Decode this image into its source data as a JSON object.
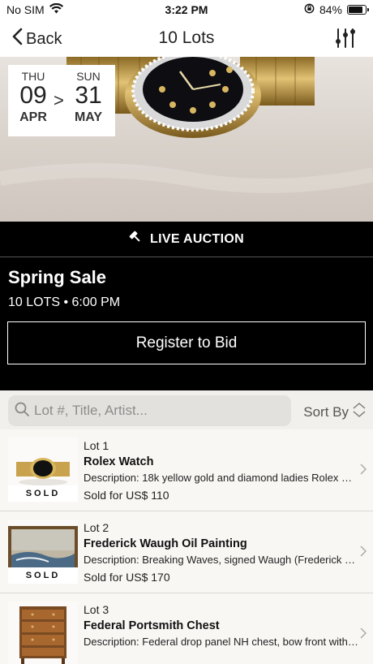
{
  "status_bar": {
    "carrier": "No SIM",
    "time": "3:22 PM",
    "battery": "84%",
    "battery_level": 0.84
  },
  "nav": {
    "back_label": "Back",
    "title": "10 Lots"
  },
  "hero": {
    "start": {
      "dow": "THU",
      "day": "09",
      "month": "APR"
    },
    "separator": ">",
    "end": {
      "dow": "SUN",
      "day": "31",
      "month": "MAY"
    }
  },
  "live_label": "LIVE AUCTION",
  "sale": {
    "name": "Spring Sale",
    "meta": "10 LOTS • 6:00 PM",
    "register_label": "Register to Bid"
  },
  "search": {
    "placeholder": "Lot #, Title, Artist...",
    "value": ""
  },
  "sort_label": "Sort By",
  "lots": [
    {
      "lot": "Lot 1",
      "title": "Rolex Watch",
      "description": "Description: 18k yellow gold and diamond ladies Rolex Datejust watch",
      "price": "Sold for US$ 110",
      "badge": "SOLD"
    },
    {
      "lot": "Lot 2",
      "title": "Frederick Waugh Oil Painting",
      "description": "Description: Breaking Waves, signed Waugh (Frederick Judd Waugh)",
      "price": "Sold for US$ 170",
      "badge": "SOLD"
    },
    {
      "lot": "Lot 3",
      "title": "Federal Portsmith Chest",
      "description": "Description: Federal drop panel NH chest, bow front with original brasses",
      "price": "",
      "badge": ""
    }
  ]
}
